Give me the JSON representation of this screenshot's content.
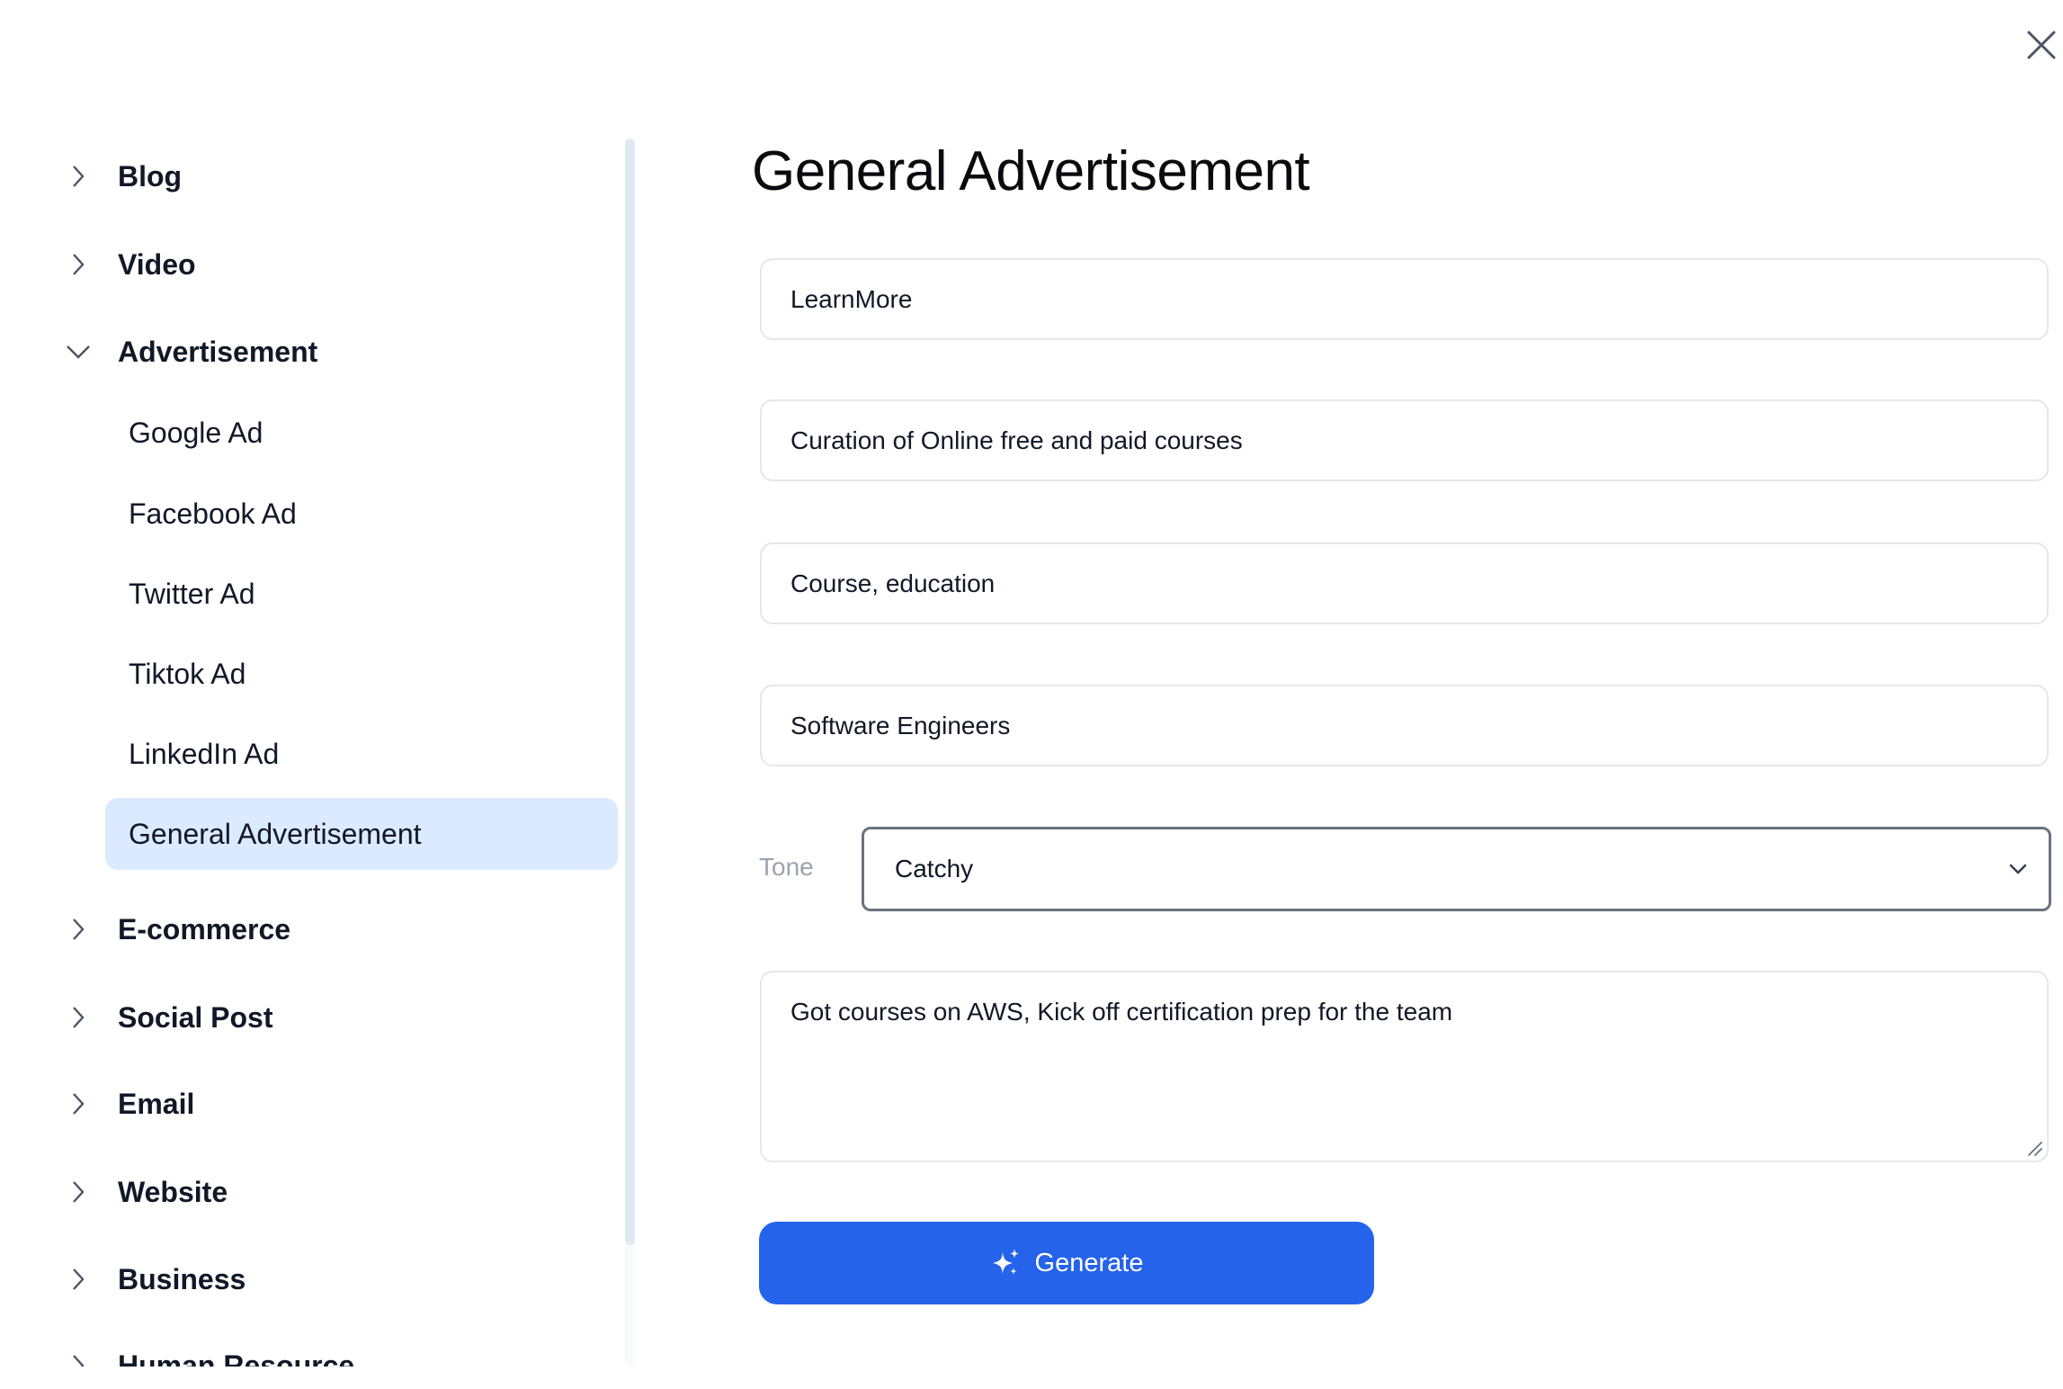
{
  "dialog": {
    "close_icon": "close-icon"
  },
  "sidebar": {
    "items": [
      {
        "label": "Blog",
        "expanded": false,
        "icon": "chevron-right-icon"
      },
      {
        "label": "Video",
        "expanded": false,
        "icon": "chevron-right-icon"
      },
      {
        "label": "Advertisement",
        "expanded": true,
        "icon": "chevron-down-icon",
        "children": [
          {
            "label": "Google Ad"
          },
          {
            "label": "Facebook Ad"
          },
          {
            "label": "Twitter Ad"
          },
          {
            "label": "Tiktok Ad"
          },
          {
            "label": "LinkedIn Ad"
          },
          {
            "label": "General Advertisement",
            "selected": true
          }
        ]
      },
      {
        "label": "E-commerce",
        "expanded": false,
        "icon": "chevron-right-icon"
      },
      {
        "label": "Social Post",
        "expanded": false,
        "icon": "chevron-right-icon"
      },
      {
        "label": "Email",
        "expanded": false,
        "icon": "chevron-right-icon"
      },
      {
        "label": "Website",
        "expanded": false,
        "icon": "chevron-right-icon"
      },
      {
        "label": "Business",
        "expanded": false,
        "icon": "chevron-right-icon"
      },
      {
        "label": "Human Resource",
        "expanded": false,
        "icon": "chevron-right-icon"
      }
    ]
  },
  "main": {
    "title": "General Advertisement",
    "fields": [
      {
        "value": "LearnMore"
      },
      {
        "value": "Curation of Online free and paid courses"
      },
      {
        "value": "Course, education"
      },
      {
        "value": "Software Engineers"
      }
    ],
    "tone": {
      "label": "Tone",
      "value": "Catchy"
    },
    "description": {
      "value": "Got courses on AWS, Kick off certification prep for the team"
    },
    "generate_button": {
      "label": "Generate",
      "icon": "sparkles-icon"
    }
  },
  "colors": {
    "accent": "#2563eb",
    "selected_bg": "#dbeafe",
    "select_border": "#6b7280",
    "input_border": "#e5e7eb",
    "muted_text": "#9ca3af"
  }
}
